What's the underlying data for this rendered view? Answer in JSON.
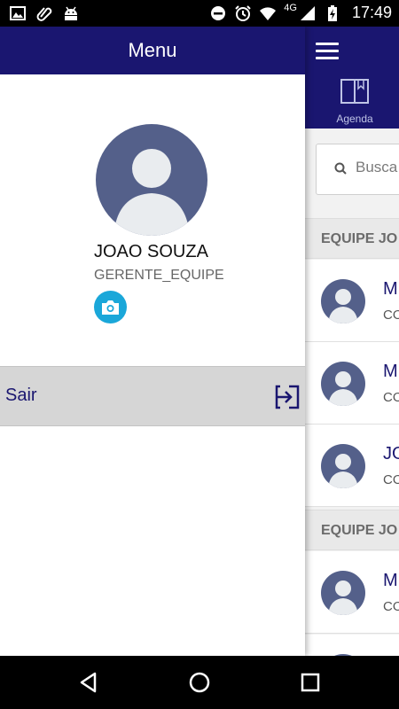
{
  "status_bar": {
    "time": "17:49",
    "network": "4G",
    "icons": [
      "image-icon",
      "attachment-icon",
      "android-icon",
      "do-not-disturb-icon",
      "alarm-icon",
      "wifi-icon",
      "signal-icon",
      "battery-charging-icon"
    ]
  },
  "drawer": {
    "title": "Menu",
    "user": {
      "name": "JOAO SOUZA",
      "role": "GERENTE_EQUIPE"
    },
    "logout_label": "Sair"
  },
  "background_screen": {
    "tab_label": "Agenda",
    "search_placeholder": "Busca",
    "sections": [
      "EQUIPE JO",
      "EQUIPE JO"
    ],
    "rows": [
      {
        "name": "M",
        "sub": "CO"
      },
      {
        "name": "M",
        "sub": "CO"
      },
      {
        "name": "JO",
        "sub": "CO"
      },
      {
        "name": "M",
        "sub": "CO"
      }
    ]
  },
  "colors": {
    "primary": "#1a1670",
    "avatar": "#54608a",
    "camera_button": "#1aa7d9",
    "logout_row": "#d6d6d6"
  }
}
